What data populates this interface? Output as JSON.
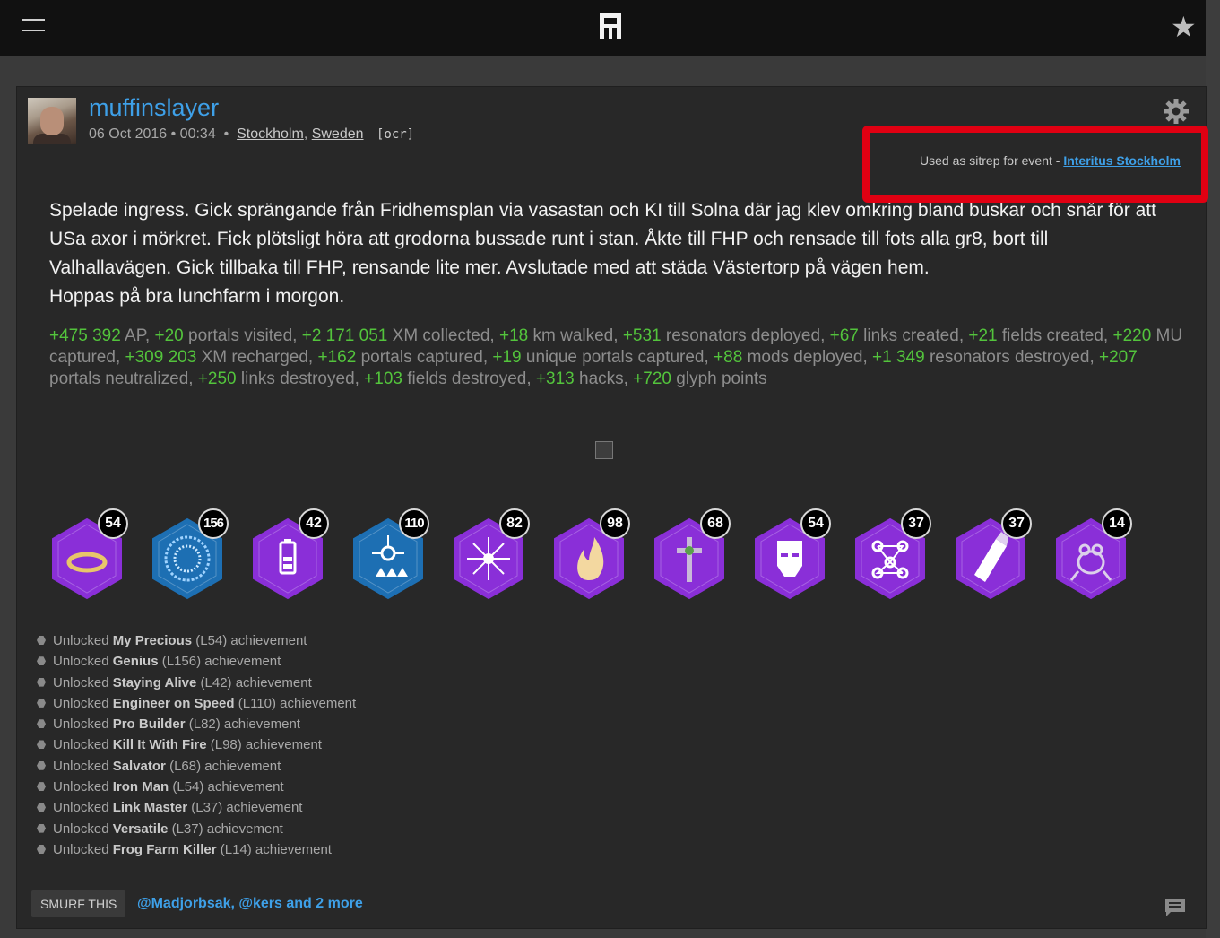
{
  "header": {
    "menu_icon": "hamburger-icon",
    "logo_icon": "ris-logo-icon",
    "favorite_icon": "star-icon"
  },
  "post": {
    "username": "muffinslayer",
    "date": "06 Oct 2016",
    "time": "00:34",
    "city": "Stockholm",
    "country": "Sweden",
    "tag": "[ocr]",
    "sitrep_prefix": "Used as sitrep for event - ",
    "sitrep_event": "Interitus Stockholm",
    "text_lines": [
      "Spelade ingress. Gick sprängande från Fridhemsplan via vasastan och KI till Solna där jag klev omkring bland buskar och snår för att",
      "USa axor i mörkret. Fick plötsligt höra att grodorna bussade runt i stan. Åkte till FHP och rensade till fots alla gr8, bort till",
      "Valhallavägen. Gick tillbaka till FHP, rensande lite mer. Avslutade med att städa Västertorp på vägen hem.",
      "Hoppas på bra lunchfarm i morgon."
    ],
    "stats": [
      {
        "n": "+475 392",
        "t": "AP"
      },
      {
        "n": "+20",
        "t": "portals visited"
      },
      {
        "n": "+2 171 051",
        "t": "XM collected"
      },
      {
        "n": "+18",
        "t": "km walked"
      },
      {
        "n": "+531",
        "t": "resonators deployed"
      },
      {
        "n": "+67",
        "t": "links created"
      },
      {
        "n": "+21",
        "t": "fields created"
      },
      {
        "n": "+220",
        "t": "MU captured"
      },
      {
        "n": "+309 203",
        "t": "XM recharged"
      },
      {
        "n": "+162",
        "t": "portals captured"
      },
      {
        "n": "+19",
        "t": "unique portals captured"
      },
      {
        "n": "+88",
        "t": "mods deployed"
      },
      {
        "n": "+1 349",
        "t": "resonators destroyed"
      },
      {
        "n": "+207",
        "t": "portals neutralized"
      },
      {
        "n": "+250",
        "t": "links destroyed"
      },
      {
        "n": "+103",
        "t": "fields destroyed"
      },
      {
        "n": "+313",
        "t": "hacks"
      },
      {
        "n": "+720",
        "t": "glyph points"
      }
    ],
    "badges": [
      {
        "level": "54",
        "icon": "ring-icon",
        "color": "#8a2fd8"
      },
      {
        "level": "156",
        "icon": "genius-icon",
        "color": "#1d6fb3"
      },
      {
        "level": "42",
        "icon": "battery-icon",
        "color": "#8a2fd8"
      },
      {
        "level": "110",
        "icon": "engineer-icon",
        "color": "#1d6fb3"
      },
      {
        "level": "82",
        "icon": "builder-icon",
        "color": "#8a2fd8"
      },
      {
        "level": "98",
        "icon": "fire-icon",
        "color": "#8a2fd8"
      },
      {
        "level": "68",
        "icon": "salvator-icon",
        "color": "#8a2fd8"
      },
      {
        "level": "54",
        "icon": "iron-man-icon",
        "color": "#8a2fd8"
      },
      {
        "level": "37",
        "icon": "link-master-icon",
        "color": "#8a2fd8"
      },
      {
        "level": "37",
        "icon": "versatile-icon",
        "color": "#8a2fd8"
      },
      {
        "level": "14",
        "icon": "frog-icon",
        "color": "#8a2fd8"
      }
    ],
    "achievements": [
      {
        "pre": "Unlocked ",
        "name": "My Precious",
        "post": " (L54) achievement"
      },
      {
        "pre": "Unlocked ",
        "name": "Genius",
        "post": " (L156) achievement"
      },
      {
        "pre": "Unlocked ",
        "name": "Staying Alive",
        "post": " (L42) achievement"
      },
      {
        "pre": "Unlocked ",
        "name": "Engineer on Speed",
        "post": " (L110) achievement"
      },
      {
        "pre": "Unlocked ",
        "name": "Pro Builder",
        "post": " (L82) achievement"
      },
      {
        "pre": "Unlocked ",
        "name": "Kill It With Fire",
        "post": " (L98) achievement"
      },
      {
        "pre": "Unlocked ",
        "name": "Salvator",
        "post": " (L68) achievement"
      },
      {
        "pre": "Unlocked ",
        "name": "Iron Man",
        "post": " (L54) achievement"
      },
      {
        "pre": "Unlocked ",
        "name": "Link Master",
        "post": " (L37) achievement"
      },
      {
        "pre": "Unlocked ",
        "name": "Versatile",
        "post": " (L37) achievement"
      },
      {
        "pre": "Unlocked ",
        "name": "Frog Farm Killer",
        "post": " (L14) achievement"
      }
    ],
    "smurf_label": "SMURF THIS",
    "smurfer1": "@Madjorbsak",
    "sep": ", ",
    "smurfer2": "@kers",
    "smurf_more": " and 2 more"
  },
  "colors": {
    "accent": "#3ea0e8",
    "stat_green": "#53c43c",
    "highlight_red": "#e00012"
  }
}
